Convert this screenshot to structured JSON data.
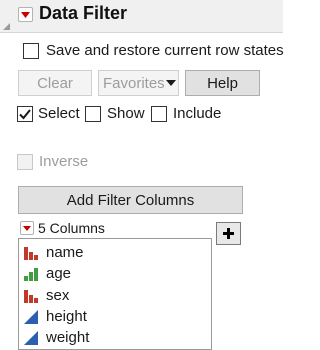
{
  "header": {
    "title": "Data Filter"
  },
  "options": {
    "save_restore_label": "Save and restore current row states"
  },
  "buttons": {
    "clear": "Clear",
    "favorites": "Favorites",
    "help": "Help",
    "add_filter_columns": "Add Filter Columns"
  },
  "modes": {
    "select": {
      "label": "Select",
      "checked": true
    },
    "show": {
      "label": "Show",
      "checked": false
    },
    "include": {
      "label": "Include",
      "checked": false
    }
  },
  "inverse": {
    "label": "Inverse",
    "checked": false,
    "enabled": false
  },
  "columns": {
    "header": "5 Columns",
    "items": [
      {
        "label": "name",
        "icon": "nominal-icon"
      },
      {
        "label": "age",
        "icon": "ordinal-icon"
      },
      {
        "label": "sex",
        "icon": "nominal-icon"
      },
      {
        "label": "height",
        "icon": "continuous-icon"
      },
      {
        "label": "weight",
        "icon": "continuous-icon"
      }
    ]
  },
  "colors": {
    "disclosure_red": "#cc0000",
    "nominal_red": "#c0392b",
    "ordinal_green": "#3f9e3f",
    "continuous_blue": "#2b5fb0"
  }
}
